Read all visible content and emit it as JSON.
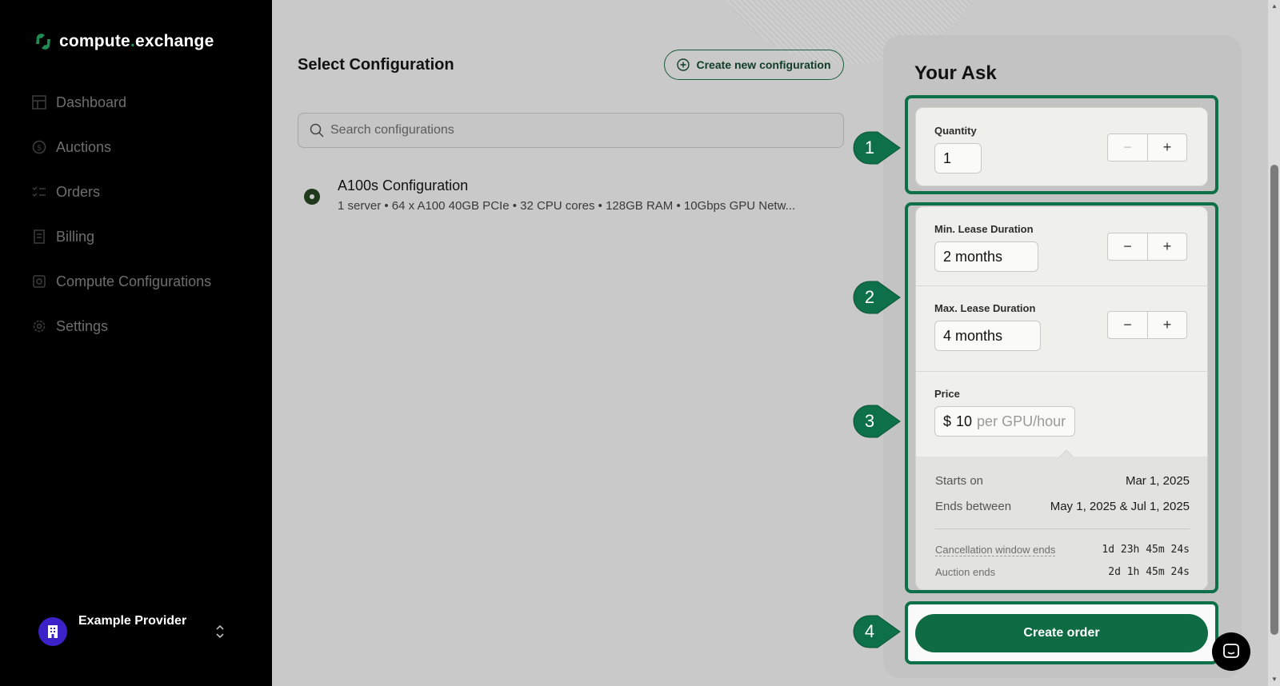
{
  "brand": {
    "name_part1": "compute",
    "name_dot": ".",
    "name_part2": "exchange",
    "accent": "#1f8a52"
  },
  "sidebar": {
    "items": [
      {
        "label": "Dashboard",
        "icon": "grid-icon"
      },
      {
        "label": "Auctions",
        "icon": "dollar-circle-icon"
      },
      {
        "label": "Orders",
        "icon": "checklist-icon"
      },
      {
        "label": "Billing",
        "icon": "receipt-icon"
      },
      {
        "label": "Compute Configurations",
        "icon": "chip-icon"
      },
      {
        "label": "Settings",
        "icon": "gear-icon"
      }
    ],
    "user": {
      "name": "Example Provider"
    }
  },
  "main": {
    "title": "Select Configuration",
    "new_config_label": "Create new configuration",
    "search_placeholder": "Search configurations",
    "configuration": {
      "name": "A100s Configuration",
      "description": "1 server • 64 x A100 40GB PCIe • 32 CPU cores • 128GB RAM • 10Gbps GPU Netw..."
    }
  },
  "ask": {
    "title": "Your Ask",
    "quantity": {
      "label": "Quantity",
      "value": "1"
    },
    "min_lease": {
      "label": "Min. Lease Duration",
      "value": "2 months"
    },
    "max_lease": {
      "label": "Max. Lease Duration",
      "value": "4 months"
    },
    "price": {
      "label": "Price",
      "currency": "$",
      "value": "10",
      "unit": "per GPU/hour"
    },
    "summary": {
      "starts_label": "Starts on",
      "starts_value": "Mar 1, 2025",
      "ends_label": "Ends between",
      "ends_value": "May 1, 2025 & Jul 1, 2025",
      "cancel_label": "Cancellation window ends",
      "cancel_value": "1d 23h 45m 24s",
      "auction_label": "Auction ends",
      "auction_value": "2d 1h 45m 24s"
    },
    "create_label": "Create order",
    "stepper": {
      "minus": "−",
      "plus": "+"
    }
  },
  "callouts": [
    "1",
    "2",
    "3",
    "4"
  ],
  "colors": {
    "highlight": "#0e7048",
    "button": "#0f6b43"
  }
}
